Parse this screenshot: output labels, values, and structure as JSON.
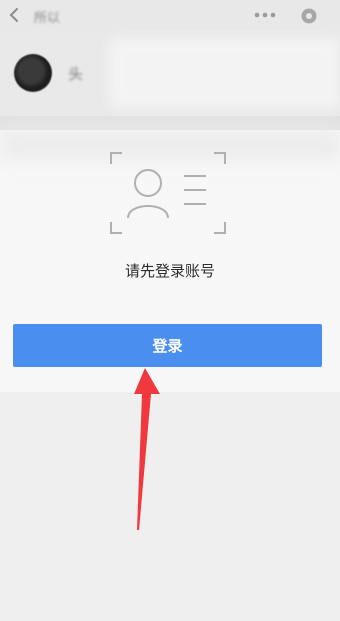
{
  "header": {
    "title": "所以",
    "back_icon": "back-chevron-icon",
    "more_icon": "more-dots-icon",
    "settings_icon": "gear-icon"
  },
  "profile": {
    "name": "头",
    "avatar_icon": "avatar-icon"
  },
  "login_card": {
    "illustration_icon": "user-card-icon",
    "prompt": "请先登录账号",
    "button_label": "登录"
  },
  "colors": {
    "accent": "#4a8ff0",
    "annotation_arrow": "#f0383e"
  }
}
